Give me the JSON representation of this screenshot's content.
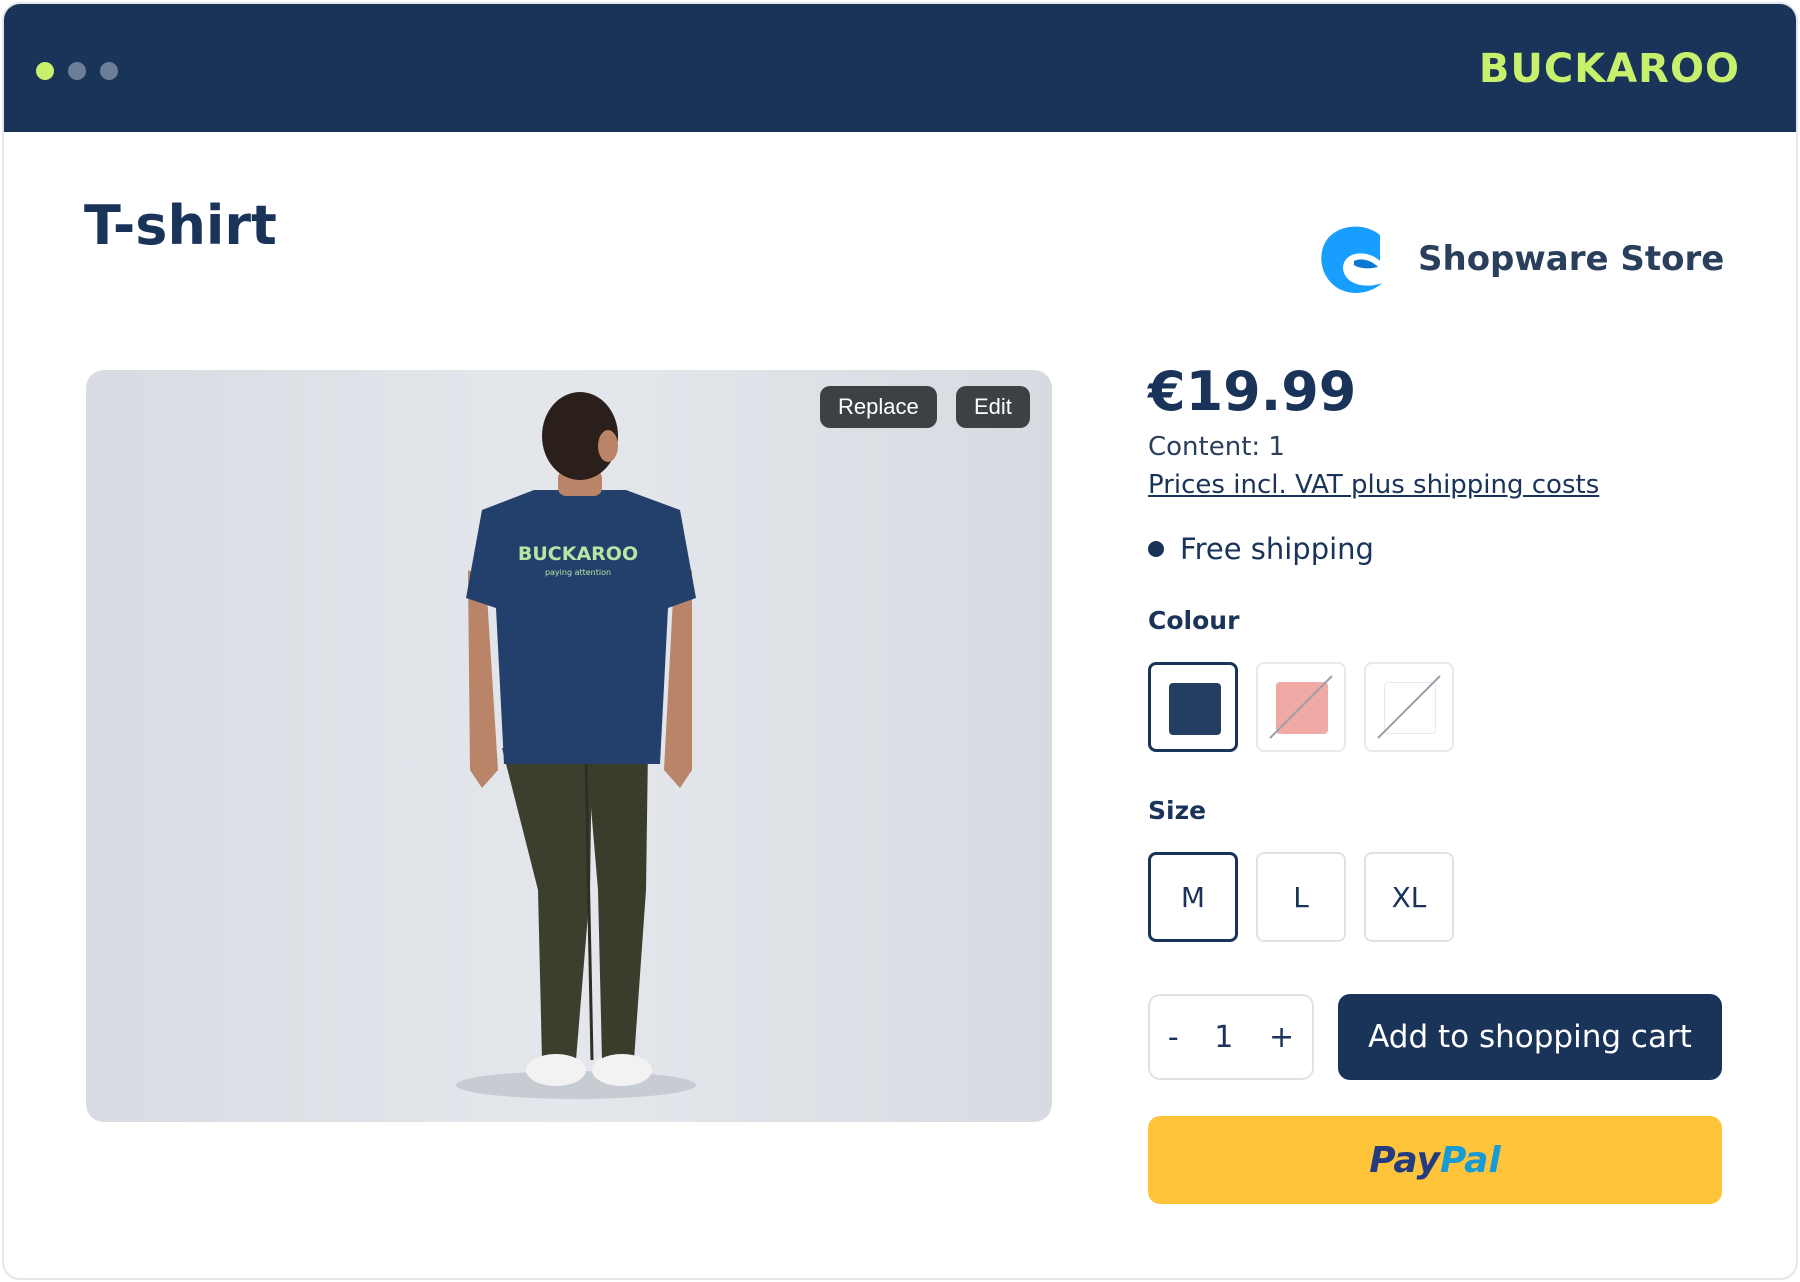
{
  "header": {
    "brand": "BUCKAROO",
    "brand_color": "#c7f06c",
    "background": "#193359"
  },
  "product": {
    "title": "T-shirt",
    "price": "€19.99",
    "content": "Content: 1",
    "vat_link": "Prices incl. VAT plus shipping costs",
    "shipping": "Free shipping"
  },
  "store": {
    "name": "Shopware Store",
    "logo_icon": "shopware-logo-icon"
  },
  "image": {
    "replace_label": "Replace",
    "edit_label": "Edit",
    "shirt_text": "BUCKAROO",
    "shirt_subtext": "paying attention"
  },
  "colour": {
    "label": "Colour",
    "options": [
      {
        "color": "#243e62",
        "selected": true,
        "available": true
      },
      {
        "color": "#efaaa6",
        "selected": false,
        "available": false
      },
      {
        "color": "#ffffff",
        "selected": false,
        "available": false
      }
    ]
  },
  "size": {
    "label": "Size",
    "options": [
      {
        "label": "M",
        "selected": true
      },
      {
        "label": "L",
        "selected": false
      },
      {
        "label": "XL",
        "selected": false
      }
    ]
  },
  "quantity": {
    "minus": "-",
    "value": "1",
    "plus": "+"
  },
  "actions": {
    "add_to_cart": "Add to shopping cart",
    "paypal_pay": "Pay",
    "paypal_pal": "Pal",
    "paypal_color": "#ffc439"
  }
}
